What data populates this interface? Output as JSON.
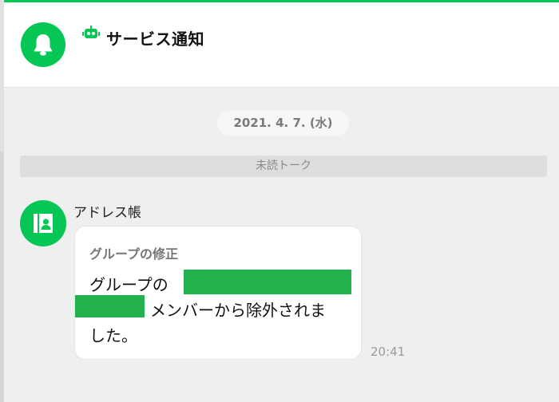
{
  "header": {
    "title": "サービス通知",
    "avatar_icon": "bell-icon",
    "badge_icon": "bot-icon"
  },
  "chat": {
    "date": "2021. 4. 7. (水)",
    "unread_label": "未読トーク",
    "message": {
      "sender": "アドレス帳",
      "sender_icon": "address-book-icon",
      "title": "グループの修正",
      "line1": "グループの",
      "line2": "メンバーから除外されま",
      "line3": "した。",
      "time": "20:41"
    }
  },
  "colors": {
    "accent": "#06c755",
    "redaction": "#22b14c",
    "background": "#efefef"
  }
}
